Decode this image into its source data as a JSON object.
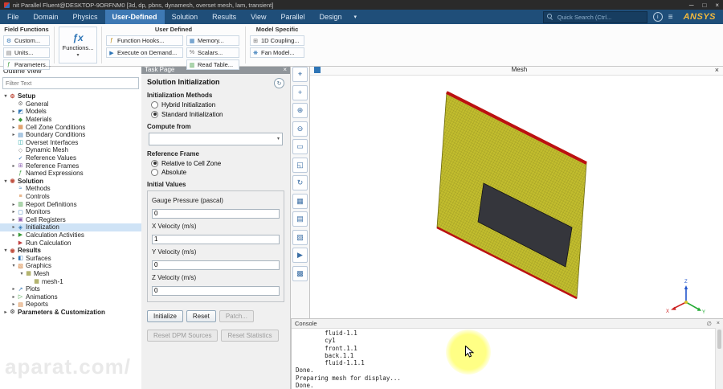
{
  "window": {
    "title": "nit Parallel Fluent@DESKTOP-9ORFNM0  [3d, dp, pbns, dynamesh, overset mesh, lam, transient]",
    "minimize_icon": "─",
    "maximize_icon": "□",
    "close_icon": "×"
  },
  "watermark": "aparat.com/",
  "ribbon": {
    "tabs": [
      {
        "label": "File",
        "active": false
      },
      {
        "label": "Domain",
        "active": false
      },
      {
        "label": "Physics",
        "active": false
      },
      {
        "label": "User-Defined",
        "active": true
      },
      {
        "label": "Solution",
        "active": false
      },
      {
        "label": "Results",
        "active": false
      },
      {
        "label": "View",
        "active": false
      },
      {
        "label": "Parallel",
        "active": false
      },
      {
        "label": "Design",
        "active": false
      }
    ],
    "more_caret": "▾",
    "search": {
      "placeholder": "Quick Search (Ctrl..."
    },
    "info_icon": "i",
    "menu_icon": "≡",
    "brand": "ANSYS",
    "groups": {
      "field_functions": {
        "title": "Field Functions",
        "items": [
          {
            "label": "Custom...",
            "icon": "custom-icon"
          },
          {
            "label": "Units...",
            "icon": "units-icon"
          },
          {
            "label": "Parameters...",
            "icon": "parameters-icon"
          }
        ]
      },
      "functions_button": {
        "label": "Functions...",
        "icon_glyph": "ƒx"
      },
      "user_defined": {
        "title": "User Defined",
        "col1": [
          {
            "label": "Function Hooks...",
            "icon": "function-hooks-icon"
          },
          {
            "label": "Execute on Demand...",
            "icon": "execute-on-demand-icon"
          }
        ],
        "col2": [
          {
            "label": "Memory...",
            "icon": "memory-icon"
          },
          {
            "label": "Scalars...",
            "icon": "scalars-icon"
          },
          {
            "label": "Read Table...",
            "icon": "read-table-icon"
          }
        ]
      },
      "model_specific": {
        "title": "Model Specific",
        "items": [
          {
            "label": "1D Coupling...",
            "icon": "coupling-icon"
          },
          {
            "label": "Fan Model...",
            "icon": "fan-model-icon"
          }
        ]
      }
    }
  },
  "outline": {
    "title": "Outline View",
    "filter_placeholder": "Filter Text",
    "tree": [
      {
        "label": "Setup",
        "depth": 0,
        "bold": true,
        "icon": "setup-icon",
        "expander": "expanded"
      },
      {
        "label": "General",
        "depth": 1,
        "icon": "general-icon",
        "expander": "none"
      },
      {
        "label": "Models",
        "depth": 1,
        "icon": "models-icon",
        "expander": "collapsed"
      },
      {
        "label": "Materials",
        "depth": 1,
        "icon": "materials-icon",
        "expander": "collapsed"
      },
      {
        "label": "Cell Zone Conditions",
        "depth": 1,
        "icon": "cell-zone-conditions-icon",
        "expander": "collapsed"
      },
      {
        "label": "Boundary Conditions",
        "depth": 1,
        "icon": "boundary-conditions-icon",
        "expander": "collapsed"
      },
      {
        "label": "Overset Interfaces",
        "depth": 1,
        "icon": "overset-interfaces-icon",
        "expander": "none"
      },
      {
        "label": "Dynamic Mesh",
        "depth": 1,
        "icon": "dynamic-mesh-icon",
        "expander": "none"
      },
      {
        "label": "Reference Values",
        "depth": 1,
        "icon": "reference-values-icon",
        "expander": "none"
      },
      {
        "label": "Reference Frames",
        "depth": 1,
        "icon": "reference-frames-icon",
        "expander": "collapsed"
      },
      {
        "label": "Named Expressions",
        "depth": 1,
        "icon": "named-expressions-icon",
        "expander": "none"
      },
      {
        "label": "Solution",
        "depth": 0,
        "bold": true,
        "icon": "solution-icon",
        "expander": "expanded"
      },
      {
        "label": "Methods",
        "depth": 1,
        "icon": "methods-icon",
        "expander": "none"
      },
      {
        "label": "Controls",
        "depth": 1,
        "icon": "controls-icon",
        "expander": "none"
      },
      {
        "label": "Report Definitions",
        "depth": 1,
        "icon": "report-definitions-icon",
        "expander": "collapsed"
      },
      {
        "label": "Monitors",
        "depth": 1,
        "icon": "monitors-icon",
        "expander": "collapsed"
      },
      {
        "label": "Cell Registers",
        "depth": 1,
        "icon": "cell-registers-icon",
        "expander": "collapsed"
      },
      {
        "label": "Initialization",
        "depth": 1,
        "icon": "initialization-icon",
        "expander": "collapsed",
        "selected": true
      },
      {
        "label": "Calculation Activities",
        "depth": 1,
        "icon": "calculation-activities-icon",
        "expander": "collapsed"
      },
      {
        "label": "Run Calculation",
        "depth": 1,
        "icon": "run-calculation-icon",
        "expander": "none"
      },
      {
        "label": "Results",
        "depth": 0,
        "bold": true,
        "icon": "results-icon",
        "expander": "expanded"
      },
      {
        "label": "Surfaces",
        "depth": 1,
        "icon": "surfaces-icon",
        "expander": "collapsed"
      },
      {
        "label": "Graphics",
        "depth": 1,
        "icon": "graphics-icon",
        "expander": "expanded"
      },
      {
        "label": "Mesh",
        "depth": 2,
        "icon": "mesh-icon",
        "expander": "expanded"
      },
      {
        "label": "mesh-1",
        "depth": 3,
        "icon": "mesh-1-icon",
        "expander": "none"
      },
      {
        "label": "Plots",
        "depth": 1,
        "icon": "plots-icon",
        "expander": "collapsed"
      },
      {
        "label": "Animations",
        "depth": 1,
        "icon": "animations-icon",
        "expander": "collapsed"
      },
      {
        "label": "Reports",
        "depth": 1,
        "icon": "reports-icon",
        "expander": "collapsed"
      },
      {
        "label": "Parameters & Customization",
        "depth": 0,
        "bold": true,
        "icon": "parameters-customization-icon",
        "expander": "collapsed"
      }
    ]
  },
  "task_page": {
    "title": "Task Page",
    "close_icon": "×",
    "refresh_icon": "↻",
    "heading": "Solution Initialization",
    "sections": {
      "init_methods": {
        "label": "Initialization Methods",
        "options": [
          {
            "label": "Hybrid Initialization",
            "checked": false
          },
          {
            "label": "Standard Initialization",
            "checked": true
          }
        ]
      },
      "compute_from": {
        "label": "Compute from",
        "value": "",
        "caret": "▾"
      },
      "reference_frame": {
        "label": "Reference Frame",
        "options": [
          {
            "label": "Relative to Cell Zone",
            "checked": true
          },
          {
            "label": "Absolute",
            "checked": false
          }
        ]
      },
      "initial_values": {
        "label": "Initial Values",
        "fields": [
          {
            "label": "Gauge Pressure (pascal)",
            "value": "0"
          },
          {
            "label": "X Velocity (m/s)",
            "value": "1"
          },
          {
            "label": "Y Velocity (m/s)",
            "value": "0"
          },
          {
            "label": "Z Velocity (m/s)",
            "value": "0"
          }
        ]
      }
    },
    "buttons": [
      {
        "label": "Initialize",
        "enabled": true
      },
      {
        "label": "Reset",
        "enabled": true
      },
      {
        "label": "Patch...",
        "enabled": false
      }
    ],
    "buttons_secondary": [
      {
        "label": "Reset DPM Sources",
        "enabled": false
      },
      {
        "label": "Reset Statistics",
        "enabled": false
      }
    ]
  },
  "viewport_toolbar": {
    "buttons": [
      {
        "name": "probe",
        "icon": "probe-icon"
      },
      {
        "name": "pan",
        "icon": "pan-icon"
      },
      {
        "name": "zoom-in",
        "icon": "zoom-in-icon"
      },
      {
        "name": "zoom-out",
        "icon": "zoom-out-icon"
      },
      {
        "name": "zoom-window",
        "icon": "zoom-window-icon"
      },
      {
        "name": "fit-to-window",
        "icon": "fit-to-window-icon"
      },
      {
        "name": "rotate-view",
        "icon": "rotate-view-icon"
      },
      {
        "name": "display-grid",
        "icon": "display-grid-icon"
      },
      {
        "name": "views",
        "icon": "views-icon"
      },
      {
        "name": "snapshot",
        "icon": "snapshot-icon"
      },
      {
        "name": "animation",
        "icon": "animation-icon"
      },
      {
        "name": "mesh-display",
        "icon": "mesh-display-icon"
      }
    ]
  },
  "graphics": {
    "title": "Mesh",
    "close_icon": "×",
    "axes": {
      "x": "X",
      "y": "Y",
      "z": "Z"
    },
    "mesh_color": "#c2bd2e",
    "mesh_line_color": "#8f8c20",
    "edge_color": "#bb1111",
    "hole_color": "#35363c"
  },
  "console": {
    "title": "Console",
    "clear_icon": "∅",
    "close_icon": "×",
    "lines": [
      "        fluid-1.1",
      "        cy1",
      "        front.1.1",
      "        back.1.1",
      "        fluid-1.1.1",
      "Done.",
      "",
      "Preparing mesh for display...",
      "Done."
    ]
  },
  "icon_glyphs": {
    "custom-icon": "⚙",
    "units-icon": "▤",
    "parameters-icon": "ƒ",
    "function-hooks-icon": "ƒ",
    "execute-on-demand-icon": "▶",
    "memory-icon": "▦",
    "scalars-icon": "%",
    "read-table-icon": "▥",
    "coupling-icon": "⊞",
    "fan-model-icon": "❋",
    "setup-icon": "⚙",
    "general-icon": "⚙",
    "models-icon": "◩",
    "materials-icon": "◆",
    "cell-zone-conditions-icon": "▦",
    "boundary-conditions-icon": "▤",
    "overset-interfaces-icon": "◫",
    "dynamic-mesh-icon": "◇",
    "reference-values-icon": "✓",
    "reference-frames-icon": "⊞",
    "named-expressions-icon": "ƒ",
    "solution-icon": "◉",
    "methods-icon": "≈",
    "controls-icon": "≡",
    "report-definitions-icon": "▥",
    "monitors-icon": "▢",
    "cell-registers-icon": "▣",
    "initialization-icon": "◈",
    "calculation-activities-icon": "▶",
    "run-calculation-icon": "▶",
    "results-icon": "◉",
    "surfaces-icon": "◧",
    "graphics-icon": "▧",
    "mesh-icon": "▦",
    "mesh-1-icon": "▦",
    "plots-icon": "↗",
    "animations-icon": "▷",
    "reports-icon": "▤",
    "parameters-customization-icon": "⚙",
    "probe-icon": "⌖",
    "pan-icon": "+",
    "zoom-in-icon": "⊕",
    "zoom-out-icon": "⊖",
    "zoom-window-icon": "▭",
    "fit-to-window-icon": "◱",
    "rotate-view-icon": "↻",
    "display-grid-icon": "▦",
    "views-icon": "▤",
    "snapshot-icon": "▧",
    "animation-icon": "▶",
    "mesh-display-icon": "▩"
  }
}
